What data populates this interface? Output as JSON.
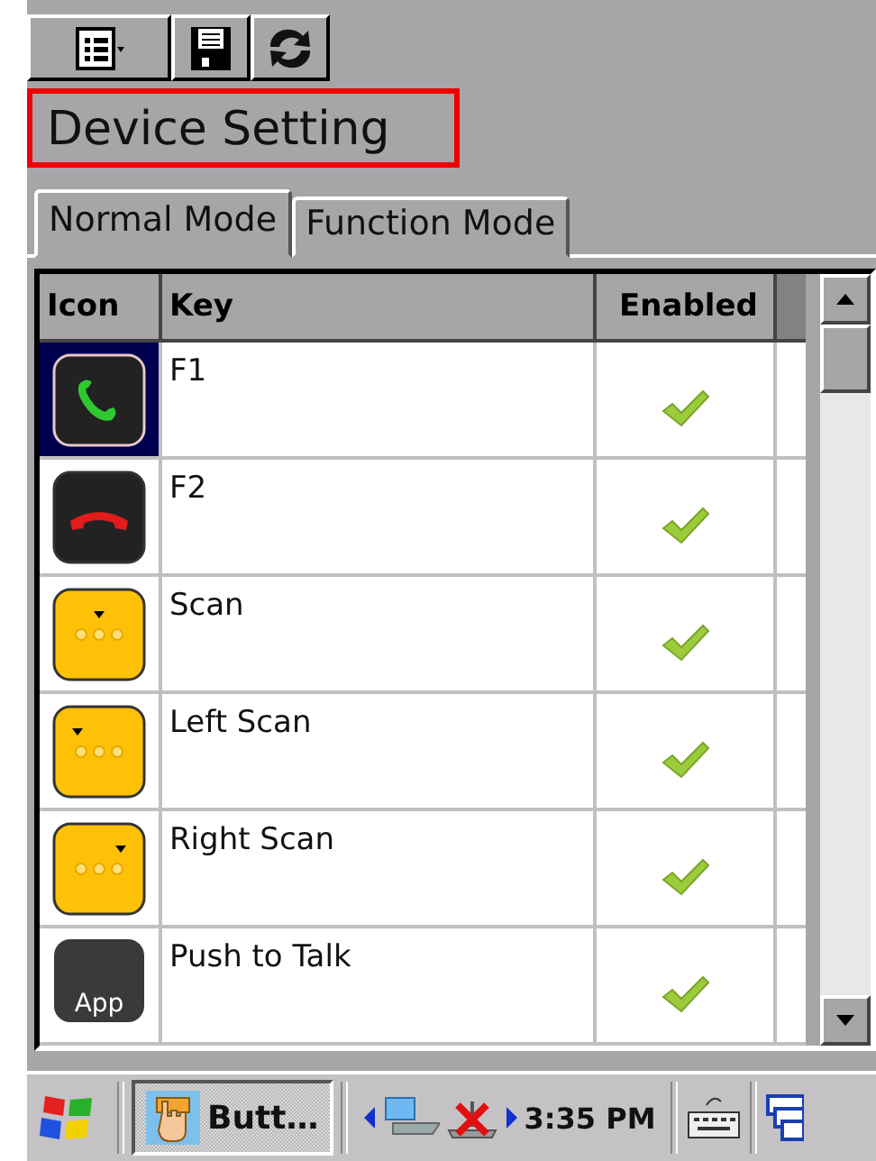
{
  "title": "Device Setting",
  "tabs": [
    {
      "label": "Normal Mode",
      "selected": true
    },
    {
      "label": "Function Mode",
      "selected": false
    }
  ],
  "table": {
    "columns": [
      "Icon",
      "Key",
      "Enabled"
    ],
    "rows": [
      {
        "kind": "call-green",
        "key": "F1",
        "enabled": true,
        "selected": true
      },
      {
        "kind": "call-red",
        "key": "F2",
        "enabled": true,
        "selected": false
      },
      {
        "kind": "scan-center",
        "key": "Scan",
        "enabled": true,
        "selected": false
      },
      {
        "kind": "scan-left",
        "key": "Left Scan",
        "enabled": true,
        "selected": false
      },
      {
        "kind": "scan-right",
        "key": "Right Scan",
        "enabled": true,
        "selected": false
      },
      {
        "kind": "app",
        "icon_text": "App",
        "key": "Push to Talk",
        "enabled": true,
        "selected": false
      }
    ]
  },
  "taskbar": {
    "task": "Butt…",
    "time": "3:35 PM"
  }
}
